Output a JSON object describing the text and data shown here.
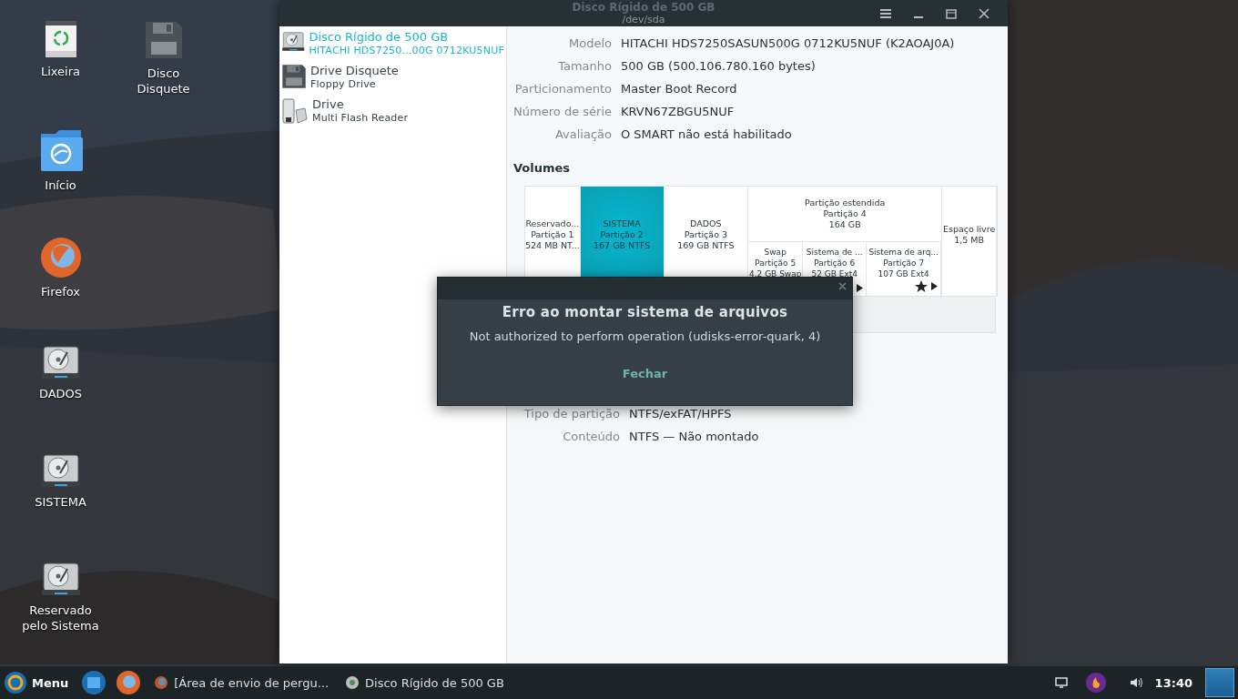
{
  "desktop_icons": [
    {
      "label": "Lixeira",
      "kind": "trash"
    },
    {
      "label": "Disco Disquete",
      "kind": "floppy"
    },
    {
      "label": "Início",
      "kind": "home"
    },
    {
      "label": "Firefox",
      "kind": "firefox"
    },
    {
      "label": "DADOS",
      "kind": "drive"
    },
    {
      "label": "SISTEMA",
      "kind": "drive"
    },
    {
      "label": "Reservado pelo Sistema",
      "kind": "drive"
    }
  ],
  "window": {
    "title": "Disco Rígido de 500 GB",
    "subtitle": "/dev/sda"
  },
  "sidebar": {
    "drives": [
      {
        "name": "Disco Rígido de 500 GB",
        "detail": "HITACHI HDS7250...00G 0712KU5NUF",
        "kind": "hdd",
        "selected": true
      },
      {
        "name": "Drive Disquete",
        "detail": "Floppy Drive",
        "kind": "floppy",
        "selected": false
      },
      {
        "name": "Drive",
        "detail": "Multi Flash Reader",
        "kind": "flash",
        "selected": false
      }
    ]
  },
  "details": [
    {
      "label": "Modelo",
      "value": "HITACHI HDS7250SASUN500G 0712KU5NUF (K2AOAJ0A)"
    },
    {
      "label": "Tamanho",
      "value": "500 GB (500.106.780.160 bytes)"
    },
    {
      "label": "Particionamento",
      "value": "Master Boot Record"
    },
    {
      "label": "Número de série",
      "value": "KRVN67ZBGU5NUF"
    },
    {
      "label": "Avaliação",
      "value": "O SMART não está habilitado"
    }
  ],
  "volumes": {
    "heading": "Volumes",
    "partitions": [
      {
        "kind": "partition",
        "lines": [
          "Reservado...",
          "Partição 1",
          "524 MB NT..."
        ],
        "selected": false
      },
      {
        "kind": "partition",
        "lines": [
          "SISTEMA",
          "Partição 2",
          "167 GB NTFS"
        ],
        "selected": true
      },
      {
        "kind": "partition",
        "lines": [
          "DADOS",
          "Partição 3",
          "169 GB NTFS"
        ],
        "selected": false
      },
      {
        "kind": "extended",
        "lines": [
          "Partição estendida",
          "Partição 4",
          "164 GB"
        ],
        "selected": false,
        "children": [
          {
            "lines": [
              "Swap",
              "Partição 5",
              "4,2 GB Swap"
            ],
            "selected": false
          },
          {
            "lines": [
              "Sistema de ...",
              "Partição 6",
              "52 GB Ext4"
            ],
            "selected": false,
            "mounted": false
          },
          {
            "lines": [
              "Sistema de arq...",
              "Partição 7",
              "107 GB Ext4"
            ],
            "selected": false,
            "mounted": false,
            "system": true
          }
        ]
      },
      {
        "kind": "free",
        "lines": [
          "Espaço livre",
          "1,5 MB"
        ],
        "selected": false
      }
    ]
  },
  "volume_details": [
    {
      "label": "Tipo de partição",
      "value": "NTFS/exFAT/HPFS"
    },
    {
      "label": "Conteúdo",
      "value": "NTFS — Não montado"
    }
  ],
  "dialog": {
    "title": "Erro ao montar sistema de arquivos",
    "message": "Not authorized to perform operation (udisks-error-quark, 4)",
    "button": "Fechar"
  },
  "taskbar": {
    "menu": "Menu",
    "tasks": [
      {
        "label": "[Área de envio de pergu...",
        "kind": "browser"
      },
      {
        "label": "Disco Rígido de 500 GB",
        "kind": "disks"
      }
    ],
    "clock": "13:40"
  }
}
